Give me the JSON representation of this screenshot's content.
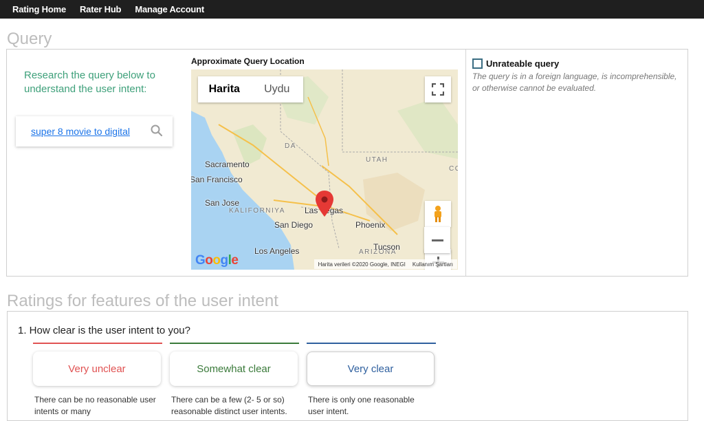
{
  "nav": {
    "items": [
      "Rating Home",
      "Rater Hub",
      "Manage Account"
    ]
  },
  "query_section": {
    "title": "Query",
    "instruction": "Research the query below to understand the user intent:",
    "query_text": "super 8 movie to digital",
    "map_label": "Approximate Query Location",
    "map": {
      "tab_map": "Harita",
      "tab_satellite": "Uydu",
      "places": {
        "sacramento": "Sacramento",
        "san_francisco": "San Francisco",
        "san_jose": "San Jose",
        "las_vegas": "Las Vegas",
        "los_angeles": "Los Angeles",
        "san_diego": "San Diego",
        "phoenix": "Phoenix",
        "tucson": "Tucson"
      },
      "regions": {
        "utah": "UTAH",
        "california": "KALIFORNIYA",
        "arizona": "ARIZONA",
        "nevada_partial": "DA",
        "colorado_partial": "CO"
      },
      "logo": "Google",
      "attribution": "Harita verileri ©2020 Google, INEGI",
      "terms": "Kullanım Şartları"
    },
    "unrateable": {
      "label": "Unrateable query",
      "description": "The query is in a foreign language, is incomprehensible, or otherwise cannot be evaluated."
    }
  },
  "ratings_section": {
    "title": "Ratings for features of the user intent",
    "question": "1. How clear is the user intent to you?",
    "options": [
      {
        "label": "Very unclear",
        "color": "#e05252",
        "description": "There can be no reasonable user intents or many"
      },
      {
        "label": "Somewhat clear",
        "color": "#3a7a3a",
        "description": "There can be a few (2- 5 or so) reasonable distinct user intents."
      },
      {
        "label": "Very clear",
        "color": "#2e5f9e",
        "description": "There is only one reasonable user intent."
      }
    ]
  }
}
